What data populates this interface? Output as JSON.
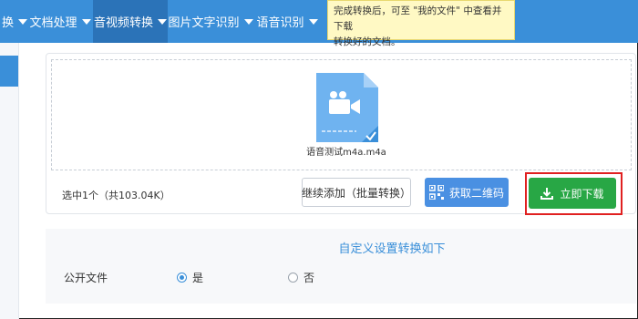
{
  "nav": {
    "items": [
      {
        "label": "换",
        "active": false
      },
      {
        "label": "文档处理",
        "active": false
      },
      {
        "label": "音视频转换",
        "active": true
      },
      {
        "label": "图片文字识别",
        "active": false
      },
      {
        "label": "语音识别",
        "active": false
      }
    ]
  },
  "tooltip": {
    "line1": "完成转换后，可至 \"我的文件\" 中查看并下载",
    "line2": "转换好的文档。"
  },
  "file": {
    "name": "语音测试m4a.m4a",
    "icon": "video-file-icon"
  },
  "summary": {
    "selected_text": "选中1个（共103.04K）"
  },
  "buttons": {
    "continue_label": "继续添加（批量转换）",
    "qr_label": "获取二维码",
    "download_label": "立即下载"
  },
  "settings": {
    "title": "自定义设置转换如下",
    "public_file_label": "公开文件",
    "options": [
      {
        "label": "是",
        "selected": true
      },
      {
        "label": "否",
        "selected": false
      }
    ]
  },
  "colors": {
    "nav_bg": "#3a8fd9",
    "nav_active": "#2b73b8",
    "download_green": "#28a745",
    "qr_blue": "#4a90e2",
    "highlight_red": "#e02020"
  }
}
